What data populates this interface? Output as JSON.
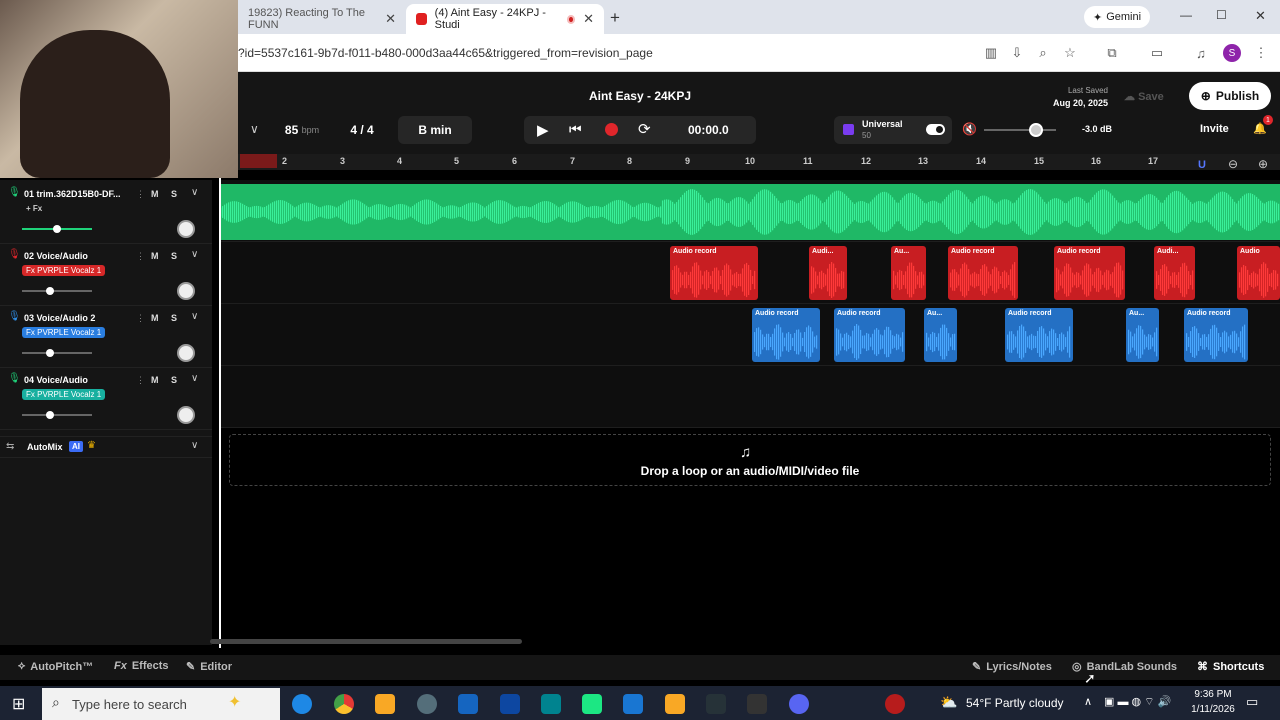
{
  "browser": {
    "tabs": [
      {
        "label": "19823) Reacting To The FUNN",
        "active": false
      },
      {
        "label": "(4) Aint Easy - 24KPJ - Studi",
        "active": true
      }
    ],
    "gemini_label": "Gemini",
    "url": "?id=5537c161-9b7d-f011-b480-000d3aa44c65&triggered_from=revision_page",
    "profile_letter": "S"
  },
  "daw": {
    "title": "Aint Easy - 24KPJ",
    "bpm": "85",
    "bpm_unit": "bpm",
    "time_sig": "4 / 4",
    "key": "B min",
    "time": "00:00.0",
    "preset_name": "Universal",
    "preset_sub": "50",
    "volume_db": "-3.0 dB",
    "volume_level": 0.72,
    "last_saved_label": "Last Saved",
    "last_saved_date": "Aug 20, 2025",
    "save_label": "Save",
    "publish_label": "Publish",
    "invite_label": "Invite",
    "notif_count": "1",
    "ruler": [
      "2",
      "3",
      "4",
      "5",
      "6",
      "7",
      "8",
      "9",
      "10",
      "11",
      "12",
      "13",
      "14",
      "15",
      "16",
      "17"
    ],
    "tracks": [
      {
        "name": "01  trim.362D15B0-DF...",
        "fx": "+ Fx",
        "fx_color": "",
        "m": "M",
        "s": "S",
        "volume": 0.5
      },
      {
        "name": "02  Voice/Audio",
        "fx": "Fx  PVRPLE Vocalz 1",
        "fx_color": "#d62828",
        "m": "M",
        "s": "S",
        "volume": 0.4
      },
      {
        "name": "03  Voice/Audio 2",
        "fx": "Fx  PVRPLE Vocalz 1",
        "fx_color": "#2a7ee0",
        "m": "M",
        "s": "S",
        "volume": 0.4
      },
      {
        "name": "04  Voice/Audio",
        "fx": "Fx  PVRPLE Vocalz 1",
        "fx_color": "#18b0a0",
        "m": "M",
        "s": "S",
        "volume": 0.4
      }
    ],
    "automix_label": "AutoMix",
    "ai_badge": "AI",
    "red_clips": [
      "Audio record",
      "Audi...",
      "Au...",
      "Audio record",
      "Audio record",
      "Audi...",
      "Audio"
    ],
    "blue_clips": [
      "Audio record",
      "Audio record",
      "Au...",
      "Audio record",
      "Au...",
      "Audio record"
    ],
    "drop_text": "Drop a loop or an audio/MIDI/video file",
    "bottom": {
      "autopitch": "AutoPitch™",
      "effects": "Effects",
      "editor": "Editor",
      "lyrics": "Lyrics/Notes",
      "sounds": "BandLab Sounds",
      "shortcuts": "Shortcuts"
    },
    "colors": {
      "green": "#1fd37a",
      "red": "#e0262b",
      "blue": "#2f8fe8"
    }
  },
  "taskbar": {
    "search_placeholder": "Type here to search",
    "weather": "54°F  Partly cloudy",
    "time": "9:36 PM",
    "date": "1/11/2026"
  }
}
